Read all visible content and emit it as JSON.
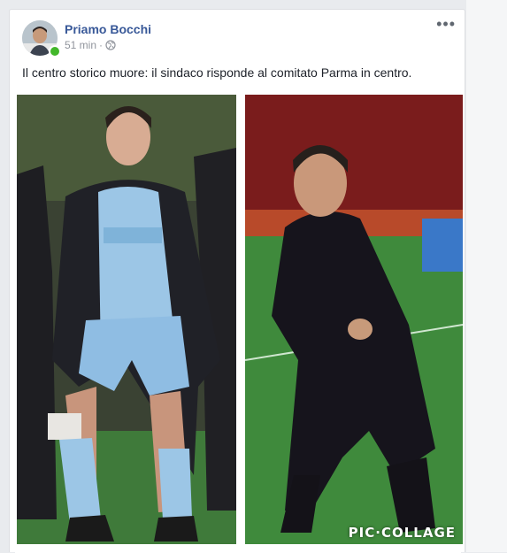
{
  "post": {
    "author": "Priamo Bocchi",
    "time": "51 min",
    "separator": "·",
    "privacy_icon": "globe-icon",
    "more_icon": "•••",
    "text": "Il centro storico muore: il sindaco risponde al comitato Parma in centro."
  },
  "photo_right": {
    "watermark": "PIC·COLLAGE"
  },
  "colors": {
    "author_link": "#385898",
    "online": "#42b72a",
    "meta": "#90949c"
  }
}
